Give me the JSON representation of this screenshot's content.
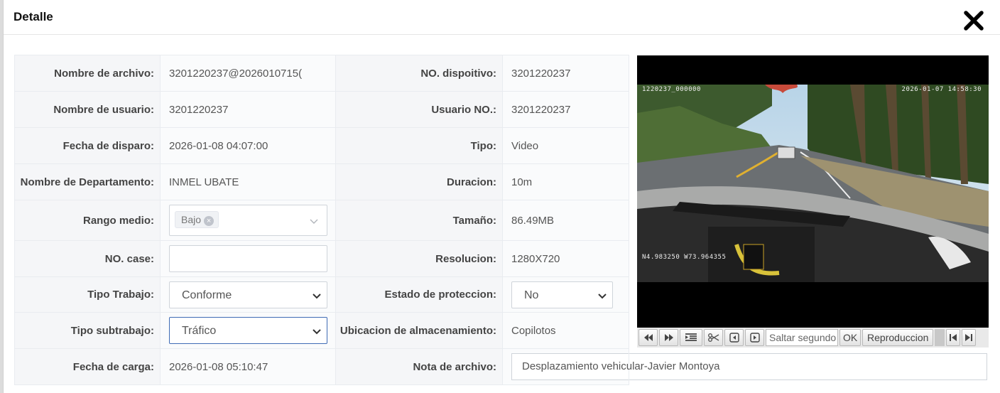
{
  "dialog": {
    "title": "Detalle"
  },
  "rows": {
    "nombre_archivo": {
      "label": "Nombre de archivo:",
      "value": "3201220237@2026010715("
    },
    "no_dispositivo": {
      "label": "NO. dispoitivo:",
      "value": "3201220237"
    },
    "nombre_usuario": {
      "label": "Nombre de usuario:",
      "value": "3201220237"
    },
    "usuario_no": {
      "label": "Usuario NO.:",
      "value": "3201220237"
    },
    "fecha_disparo": {
      "label": "Fecha de disparo:",
      "value": "2026-01-08 04:07:00"
    },
    "tipo": {
      "label": "Tipo:",
      "value": "Video"
    },
    "departamento": {
      "label": "Nombre de Departamento:",
      "value": "INMEL UBATE"
    },
    "duracion": {
      "label": "Duracion:",
      "value": "10m"
    },
    "rango_medio": {
      "label": "Rango medio:",
      "tag": "Bajo",
      "tag_close": "×"
    },
    "tamano": {
      "label": "Tamaño:",
      "value": "86.49MB"
    },
    "no_case": {
      "label": "NO. case:",
      "value": ""
    },
    "resolucion": {
      "label": "Resolucion:",
      "value": "1280X720"
    },
    "tipo_trabajo": {
      "label": "Tipo Trabajo:",
      "value": "Conforme"
    },
    "estado_proteccion": {
      "label": "Estado de proteccion:",
      "value": "No"
    },
    "tipo_subtrabajo": {
      "label": "Tipo subtrabajo:",
      "value": "Tráfico"
    },
    "ubicacion": {
      "label": "Ubicacion de almacenamiento:",
      "value": "Copilotos"
    },
    "fecha_carga": {
      "label": "Fecha de carga:",
      "value": "2026-01-08 05:10:47"
    },
    "nota_archivo": {
      "label": "Nota de archivo:",
      "value": "Desplazamiento vehicular-Javier Montoya"
    }
  },
  "video": {
    "osd_top_left": "1220237_000000",
    "osd_top_right": "2026-01-07 14:58:30",
    "osd_gps": "N4.983250 W73.964355"
  },
  "controls": {
    "seek_placeholder": "Saltar segundo",
    "ok_label": "OK",
    "play_label": "Reproduccion",
    "icons": [
      "rewind-icon",
      "fast-forward-icon",
      "list-icon",
      "scissors-icon",
      "prev-frame-icon",
      "next-frame-icon",
      "skip-start-icon",
      "skip-end-icon"
    ]
  },
  "colors": {
    "label_bg": "#f5f6f8",
    "border": "#e9ecf0",
    "focus_border": "#3f6bb5"
  }
}
